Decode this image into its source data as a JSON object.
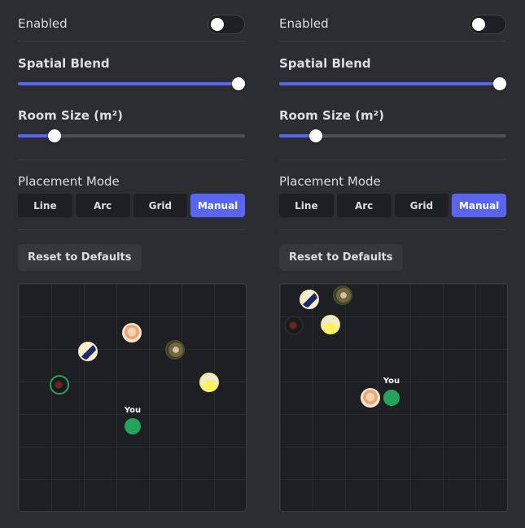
{
  "panels": [
    {
      "enabled_label": "Enabled",
      "enabled": false,
      "spatial_blend": {
        "label": "Spatial Blend",
        "value": 1.0
      },
      "room_size": {
        "label": "Room Size (m²)",
        "value": 0.16
      },
      "placement": {
        "label": "Placement Mode",
        "options": [
          "Line",
          "Arc",
          "Grid",
          "Manual"
        ],
        "selected": "Manual"
      },
      "reset_label": "Reset to Defaults",
      "you_label": "You"
    },
    {
      "enabled_label": "Enabled",
      "enabled": false,
      "spatial_blend": {
        "label": "Spatial Blend",
        "value": 1.0
      },
      "room_size": {
        "label": "Room Size (m²)",
        "value": 0.16
      },
      "placement": {
        "label": "Placement Mode",
        "options": [
          "Line",
          "Arc",
          "Grid",
          "Manual"
        ],
        "selected": "Manual"
      },
      "reset_label": "Reset to Defaults",
      "you_label": "You"
    }
  ],
  "colors": {
    "accent": "#5865f2",
    "background": "#2b2d31",
    "canvas": "#1e1f22",
    "self_marker": "#23a559"
  }
}
